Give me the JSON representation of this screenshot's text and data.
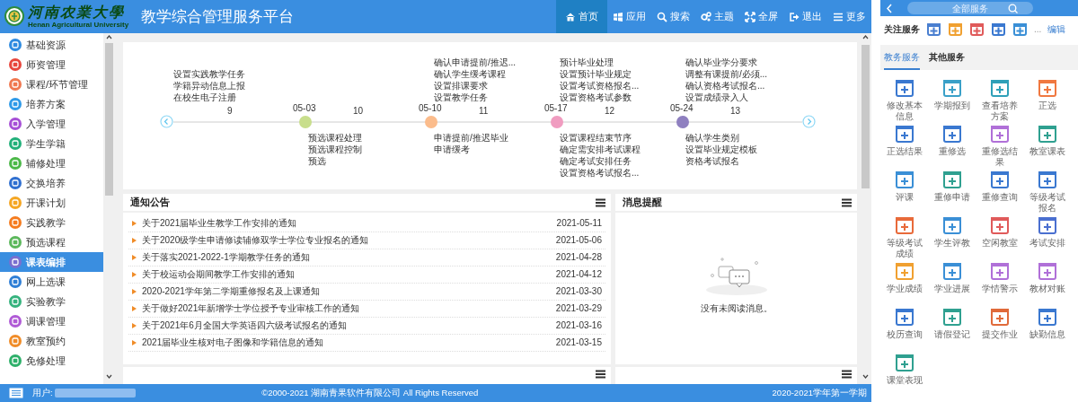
{
  "header": {
    "school_name": "河南农業大學",
    "school_name_en": "Henan Agricultural University",
    "title": "教学综合管理服务平台"
  },
  "nav": [
    {
      "label": "首页",
      "selected": true
    },
    {
      "label": "应用",
      "selected": false
    },
    {
      "label": "搜索",
      "selected": false
    },
    {
      "label": "主题",
      "selected": false
    },
    {
      "label": "全屏",
      "selected": false
    },
    {
      "label": "退出",
      "selected": false
    },
    {
      "label": "更多",
      "selected": false
    }
  ],
  "sidebar": {
    "items": [
      {
        "label": "基础资源",
        "color": "#2f8be0",
        "selected": false
      },
      {
        "label": "师资管理",
        "color": "#e8463c",
        "selected": false
      },
      {
        "label": "课程/环节管理",
        "color": "#f07850",
        "selected": false
      },
      {
        "label": "培养方案",
        "color": "#2f9ae8",
        "selected": false
      },
      {
        "label": "入学管理",
        "color": "#a64fd6",
        "selected": false
      },
      {
        "label": "学生学籍",
        "color": "#22b07a",
        "selected": false
      },
      {
        "label": "辅修处理",
        "color": "#4cb848",
        "selected": false
      },
      {
        "label": "交换培养",
        "color": "#2f6fd0",
        "selected": false
      },
      {
        "label": "开课计划",
        "color": "#f5a623",
        "selected": false
      },
      {
        "label": "实践教学",
        "color": "#f57c1f",
        "selected": false
      },
      {
        "label": "预选课程",
        "color": "#5cb85c",
        "selected": false
      },
      {
        "label": "课表编排",
        "color": "#7a6fd0",
        "selected": true
      },
      {
        "label": "网上选课",
        "color": "#2f7fd6",
        "selected": false
      },
      {
        "label": "实验教学",
        "color": "#36b37e",
        "selected": false
      },
      {
        "label": "调课管理",
        "color": "#b05ad6",
        "selected": false
      },
      {
        "label": "教室预约",
        "color": "#f08c28",
        "selected": false
      },
      {
        "label": "免修处理",
        "color": "#2eb06a",
        "selected": false
      }
    ]
  },
  "timeline": {
    "segments": [
      {
        "week": "9",
        "above": [
          "设置实践教学任务",
          "学籍异动信息上报",
          "在校生电子注册"
        ]
      },
      {
        "date": "05-03",
        "color": "#c8de8c",
        "week": "10",
        "below": [
          "预选课程处理",
          "预选课程控制",
          "预选"
        ]
      },
      {
        "date": "05-10",
        "color": "#fbbc8c",
        "week": "11",
        "above": [
          "确认申请提前/推迟...",
          "确认学生缓考课程",
          "设置排课要求",
          "设置教学任务"
        ],
        "below": [
          "申请提前/推迟毕业",
          "申请缓考"
        ]
      },
      {
        "date": "05-17",
        "color": "#f09cc0",
        "week": "12",
        "above": [
          "预计毕业处理",
          "设置预计毕业规定",
          "设置考试资格报名...",
          "设置资格考试参数"
        ],
        "below": [
          "设置课程结束节序",
          "确定需安排考试课程",
          "确定考试安排任务",
          "设置资格考试报名..."
        ]
      },
      {
        "date": "05-24",
        "color": "#8f80c0",
        "week": "13",
        "above": [
          "确认毕业学分要求",
          "调整有课提前/必须...",
          "确认资格考试报名...",
          "设置成绩录入人"
        ],
        "below": [
          "确认学生类别",
          "设置毕业规定模板",
          "资格考试报名"
        ]
      }
    ]
  },
  "notices": {
    "title": "通知公告",
    "items": [
      {
        "text": "关于2021届毕业生教学工作安排的通知",
        "date": "2021-05-11"
      },
      {
        "text": "关于2020级学生申请修读辅修双学士学位专业报名的通知",
        "date": "2021-05-06"
      },
      {
        "text": "关于落实2021-2022-1学期教学任务的通知",
        "date": "2021-04-28"
      },
      {
        "text": "关于校运动会期间教学工作安排的通知",
        "date": "2021-04-12"
      },
      {
        "text": "2020-2021学年第二学期重修报名及上课通知",
        "date": "2021-03-30"
      },
      {
        "text": "关于做好2021年新增学士学位授予专业审核工作的通知",
        "date": "2021-03-29"
      },
      {
        "text": "关于2021年6月全国大学英语四六级考试报名的通知",
        "date": "2021-03-16"
      },
      {
        "text": "2021届毕业生核对电子图像和学籍信息的通知",
        "date": "2021-03-15"
      }
    ]
  },
  "messages": {
    "title": "消息提醒",
    "empty_text": "没有未阅读消息。"
  },
  "status_bar": {
    "user_label": "用户:",
    "copyright": "©2000-2021 湖南青果软件有限公司 All Rights Reserved",
    "term": "2020-2021学年第一学期"
  },
  "services_panel": {
    "search": {
      "placeholder": "全部服务"
    },
    "followed": {
      "label": "关注服务",
      "items": [
        {
          "color": "#4a7fd0"
        },
        {
          "color": "#f0a030"
        },
        {
          "color": "#e05a5a"
        },
        {
          "color": "#3a78d0"
        },
        {
          "color": "#3a8fd6"
        }
      ],
      "more": "...",
      "edit": "编辑"
    },
    "tabs": [
      {
        "label": "教务服务",
        "selected": true
      },
      {
        "label": "其他服务",
        "selected": false
      }
    ],
    "items": [
      {
        "label": "修改基本信息",
        "color": "#3a78d0"
      },
      {
        "label": "学期报到",
        "color": "#3aa0c8"
      },
      {
        "label": "查看培养方案",
        "color": "#2fa0b8"
      },
      {
        "label": "正选",
        "color": "#f07840"
      },
      {
        "label": "正选结果",
        "color": "#3a78d0"
      },
      {
        "label": "重修选",
        "color": "#3a78d0"
      },
      {
        "label": "重修选结果",
        "color": "#b070d8"
      },
      {
        "label": "教室课表",
        "color": "#2fa090"
      },
      {
        "label": "评课",
        "color": "#3a8fd6"
      },
      {
        "label": "重修申请",
        "color": "#2fa090"
      },
      {
        "label": "重修查询",
        "color": "#3a78d0"
      },
      {
        "label": "等级考试报名",
        "color": "#3a78d0"
      },
      {
        "label": "等级考试成绩",
        "color": "#e86a3a"
      },
      {
        "label": "学生评教",
        "color": "#3a8fd6"
      },
      {
        "label": "空闲教室",
        "color": "#e05a5a"
      },
      {
        "label": "考试安排",
        "color": "#4a6fd0"
      },
      {
        "label": "学业成绩",
        "color": "#f0a030"
      },
      {
        "label": "学业进展",
        "color": "#3a8fd6"
      },
      {
        "label": "学情警示",
        "color": "#b070d8"
      },
      {
        "label": "教材对账",
        "color": "#b070d8"
      },
      {
        "label": "校历查询",
        "color": "#3a78d0"
      },
      {
        "label": "请假登记",
        "color": "#2fa090"
      },
      {
        "label": "提交作业",
        "color": "#e06a3a"
      },
      {
        "label": "缺勤信息",
        "color": "#3a78d0"
      },
      {
        "label": "课堂表现",
        "color": "#2fa090"
      }
    ]
  }
}
